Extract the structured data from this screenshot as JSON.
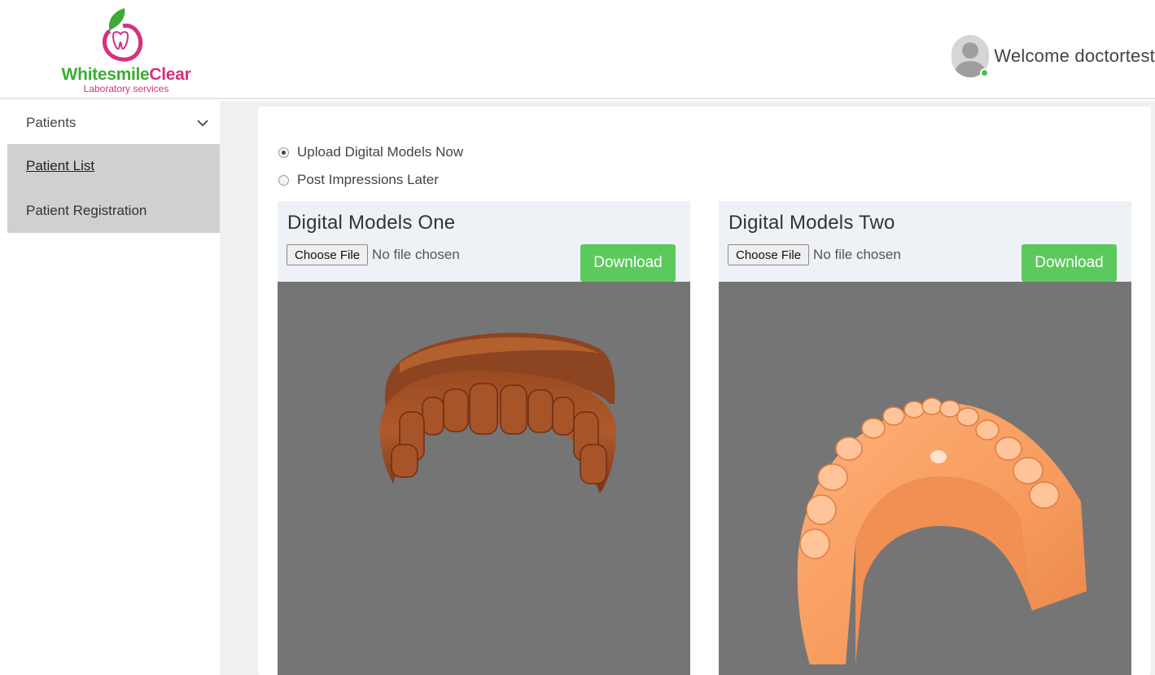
{
  "brand": {
    "name_part1": "Whitesmile",
    "name_part2": "Clear",
    "tagline": "Laboratory services"
  },
  "header": {
    "welcome_text": "Welcome doctortest",
    "status": "online"
  },
  "sidebar": {
    "section_label": "Patients",
    "items": [
      {
        "label": "Patient List",
        "active": true
      },
      {
        "label": "Patient Registration",
        "active": false
      }
    ]
  },
  "upload_options": [
    {
      "label": "Upload Digital Models Now",
      "selected": true
    },
    {
      "label": "Post Impressions Later",
      "selected": false
    }
  ],
  "panels": [
    {
      "title": "Digital Models One",
      "choose_label": "Choose File",
      "file_status": "No file chosen",
      "download_label": "Download",
      "model": "upper-arch-brown"
    },
    {
      "title": "Digital Models Two",
      "choose_label": "Choose File",
      "file_status": "No file chosen",
      "download_label": "Download",
      "model": "lower-arch-orange"
    }
  ],
  "colors": {
    "accent_green": "#5cc95c",
    "brand_green": "#3dab35",
    "brand_pink": "#d6307e",
    "viewer_bg": "#757575",
    "sidebar_active_bg": "#d0d0d0"
  }
}
